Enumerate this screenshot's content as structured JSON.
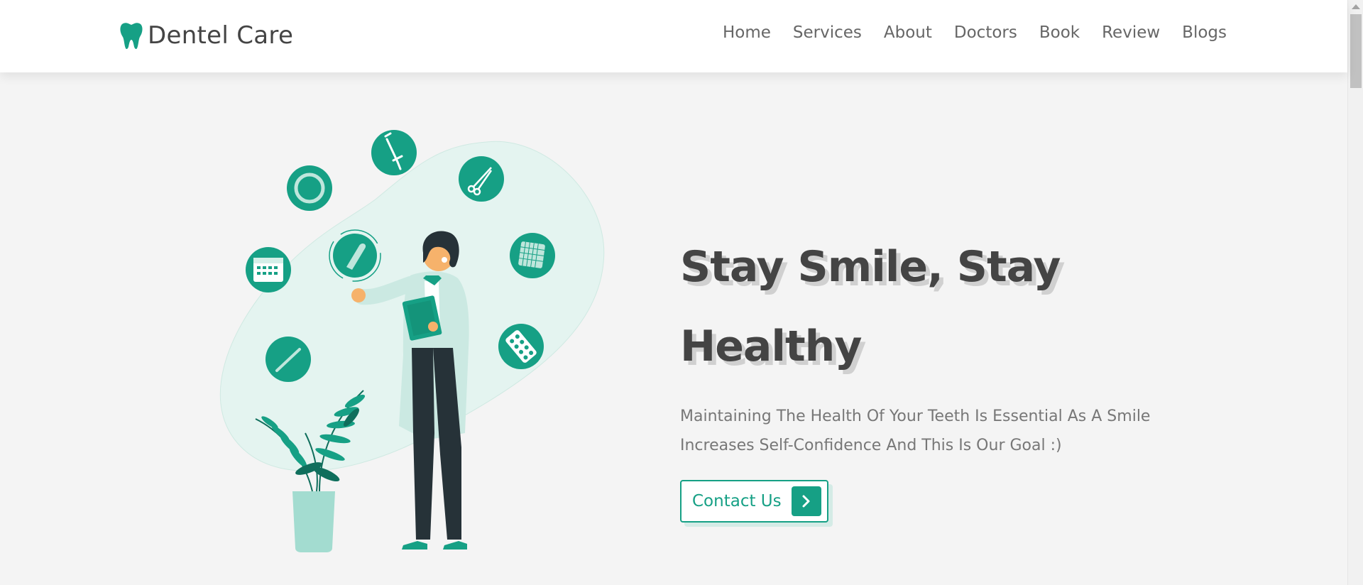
{
  "brand": {
    "name": "Dentel Care",
    "icon": "tooth-icon",
    "accent_color": "#16a085"
  },
  "nav": {
    "items": [
      {
        "label": "Home"
      },
      {
        "label": "Services"
      },
      {
        "label": "About"
      },
      {
        "label": "Doctors"
      },
      {
        "label": "Book"
      },
      {
        "label": "Review"
      },
      {
        "label": "Blogs"
      }
    ]
  },
  "hero": {
    "headline": "Stay Smile, Stay Healthy",
    "description": "Maintaining The Health Of Your Teeth Is Essential As A Smile Increases Self-Confidence And This Is Our Goal :)",
    "button": {
      "label": "Contact Us",
      "icon": "chevron-right-icon"
    },
    "illustration": {
      "subject": "dentist-illustration",
      "icons": [
        "syringe-icon",
        "scissors-icon",
        "ring-icon",
        "tooth-tool-icon",
        "calendar-icon",
        "gauze-icon",
        "pill-pack-icon",
        "dental-probe-icon"
      ]
    }
  }
}
